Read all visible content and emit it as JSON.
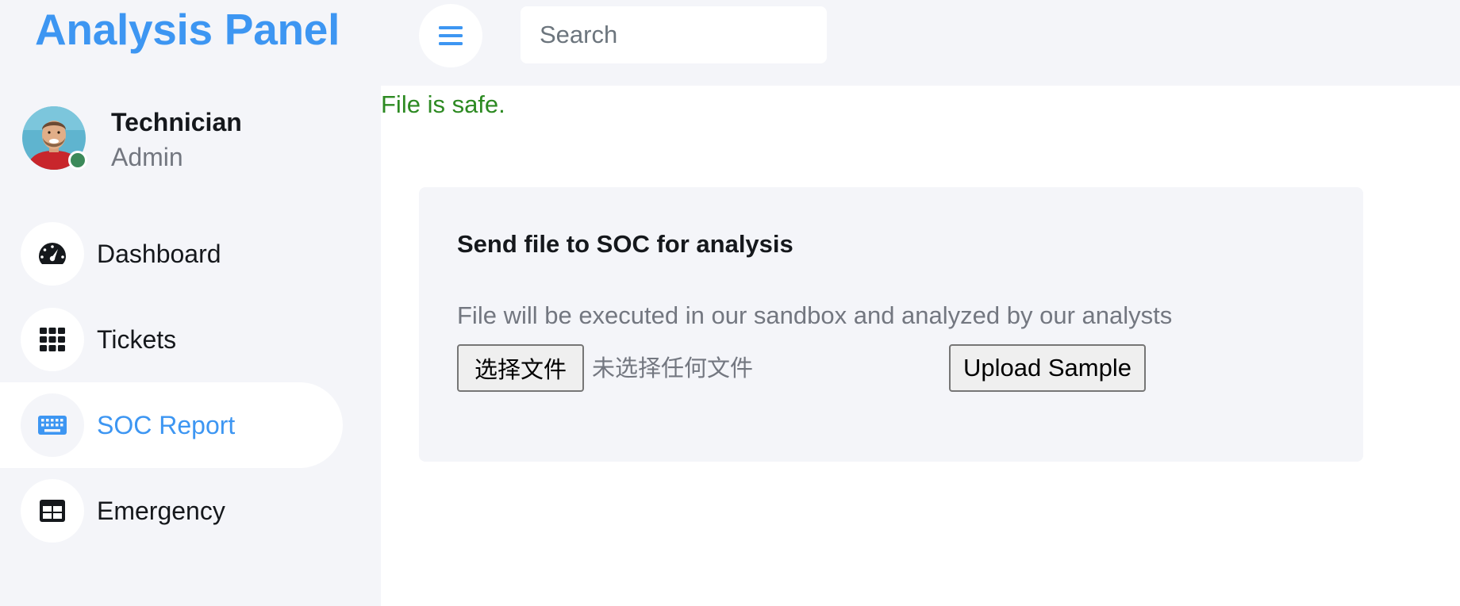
{
  "header": {
    "brand_title": "Analysis Panel",
    "menu_icon": "hamburger-menu-icon",
    "search_placeholder": "Search",
    "accent_color": "#3d96f2"
  },
  "profile": {
    "name": "Technician",
    "role": "Admin",
    "online_status_color": "#3c8a5a"
  },
  "sidebar": {
    "items": [
      {
        "label": "Dashboard",
        "icon": "speedometer-icon",
        "active": false
      },
      {
        "label": "Tickets",
        "icon": "grid-icon",
        "active": false
      },
      {
        "label": "SOC Report",
        "icon": "keyboard-icon",
        "active": true
      },
      {
        "label": "Emergency",
        "icon": "table-icon",
        "active": false
      }
    ]
  },
  "main": {
    "status_message": "File is safe.",
    "status_color": "#2d8a22",
    "card": {
      "title": "Send file to SOC for analysis",
      "description": "File will be executed in our sandbox and analyzed by our analysts",
      "file_button_label": "选择文件",
      "file_status": "未选择任何文件",
      "upload_button_label": "Upload Sample"
    }
  }
}
